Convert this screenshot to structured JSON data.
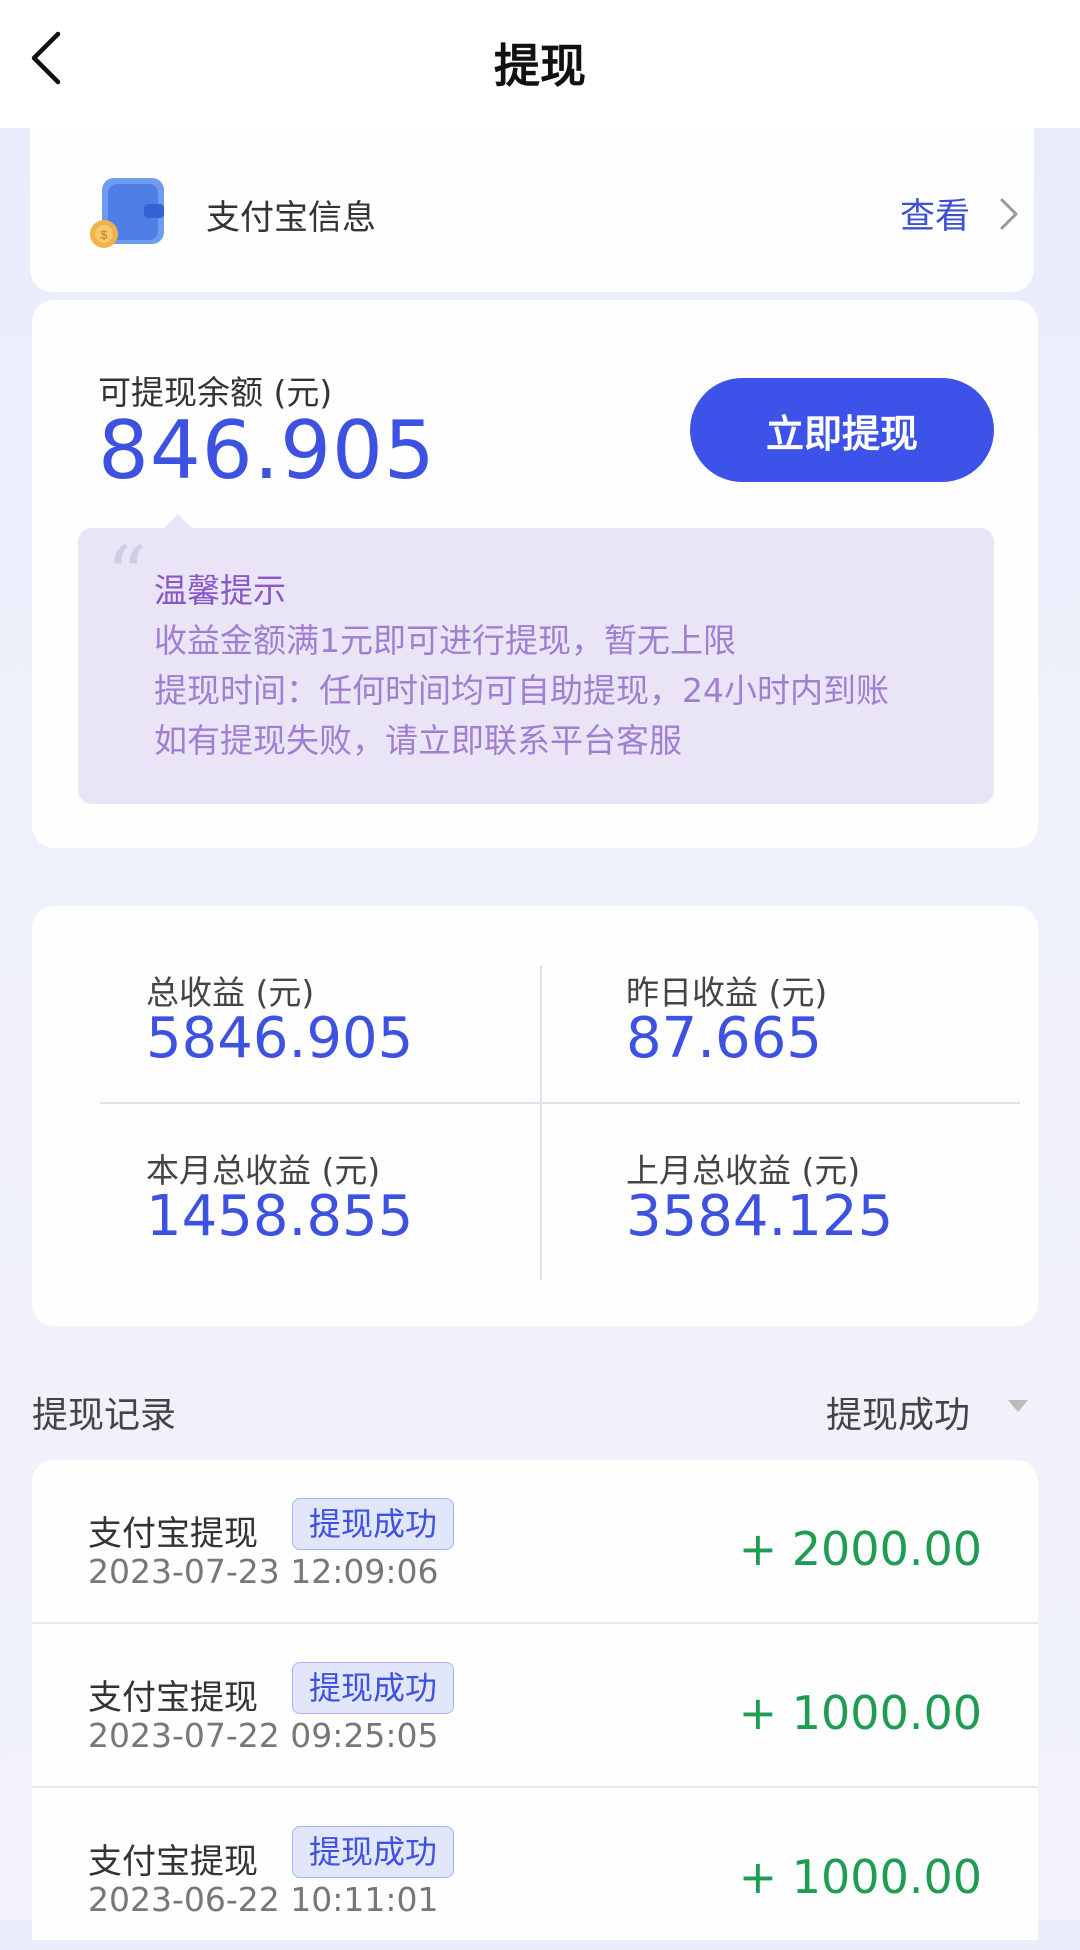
{
  "header": {
    "title": "提现"
  },
  "alipay": {
    "label": "支付宝信息",
    "view": "查看"
  },
  "balance": {
    "label": "可提现余额 (元)",
    "value": "846.905",
    "button": "立即提现"
  },
  "tips": {
    "title": "温馨提示",
    "lines": [
      "收益金额满1元即可进行提现，暂无上限",
      "提现时间：任何时间均可自助提现，24小时内到账",
      "如有提现失败，请立即联系平台客服"
    ]
  },
  "stats": [
    {
      "label": "总收益 (元)",
      "value": "5846.905"
    },
    {
      "label": "昨日收益 (元)",
      "value": "87.665"
    },
    {
      "label": "本月总收益 (元)",
      "value": "1458.855"
    },
    {
      "label": "上月总收益 (元)",
      "value": "3584.125"
    }
  ],
  "records": {
    "title": "提现记录",
    "filter": "提现成功",
    "items": [
      {
        "title": "支付宝提现",
        "status": "提现成功",
        "time": "2023-07-23 12:09:06",
        "amount": "+ 2000.00"
      },
      {
        "title": "支付宝提现",
        "status": "提现成功",
        "time": "2023-07-22 09:25:05",
        "amount": "+ 1000.00"
      },
      {
        "title": "支付宝提现",
        "status": "提现成功",
        "time": "2023-06-22 10:11:01",
        "amount": "+ 1000.00"
      }
    ]
  },
  "colors": {
    "accent": "#3d52e8",
    "amount_positive": "#1e9d52",
    "tip_text": "#a07ed1"
  }
}
